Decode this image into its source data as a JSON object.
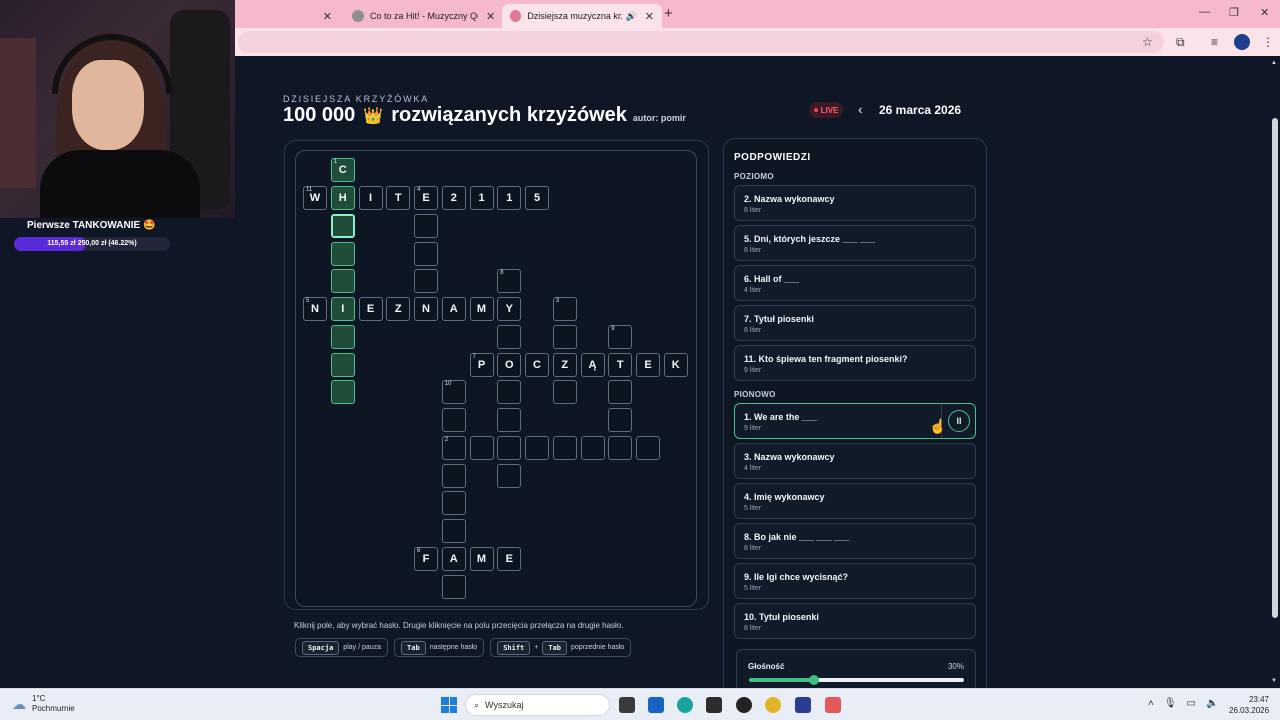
{
  "browser": {
    "tabs": [
      {
        "label": "",
        "x": 0
      },
      {
        "label": "Co to za Hit! - Muzyczny Quiz"
      },
      {
        "label": "Dzisiejsza muzyczna krzyżó"
      }
    ],
    "new_tab": "+",
    "minimize": "—",
    "restore": "❐",
    "close": "✕"
  },
  "stream": {
    "donation_title": "Pierwsze TANKOWANIE 🤩",
    "donation_text": "115,55 zł  250,00 zł (46.22%)",
    "donation_progress": 0.4622
  },
  "header": {
    "subtitle": "DZISIEJSZA KRZYŻÓWKA",
    "count": "100 000",
    "crown": "👑",
    "title": "rozwiązanych krzyżówek",
    "author": "autor: pomir",
    "live": "LIVE",
    "date_prev": "‹",
    "date": "26 marca 2026"
  },
  "board": {
    "hint": "Kliknij pole, aby wybrać hasło. Drugie kliknięcie na polu przecięcia przełącza na drugie hasło.",
    "shortcuts": [
      {
        "keys": [
          "Spacja"
        ],
        "label": "play / pauza"
      },
      {
        "keys": [
          "Tab"
        ],
        "label": "następne hasło"
      },
      {
        "keys": [
          "Shift",
          "Tab"
        ],
        "label": "poprzednie hasło"
      }
    ],
    "plus": "+"
  },
  "clues": {
    "title": "PODPOWIEDZI",
    "across_label": "POZIOMO",
    "down_label": "PIONOWO",
    "across": [
      {
        "text": "2. Nazwa wykonawcy",
        "sub": "8 liter"
      },
      {
        "text": "5. Dni, których jeszcze ___ ___",
        "sub": "8 liter"
      },
      {
        "text": "6. Hall of ___",
        "sub": "4 liter"
      },
      {
        "text": "7. Tytuł piosenki",
        "sub": "8 liter"
      },
      {
        "text": "11. Kto śpiewa ten fragment piosenki?",
        "sub": "9 liter"
      }
    ],
    "down": [
      {
        "text": "1. We are the ___",
        "sub": "9 liter",
        "active": true
      },
      {
        "text": "3. Nazwa wykonawcy",
        "sub": "4 liter"
      },
      {
        "text": "4. Imię wykonawcy",
        "sub": "5 liter"
      },
      {
        "text": "8. Bo jak nie ___ ___ ___",
        "sub": "8 liter"
      },
      {
        "text": "9. Ile Igi chce wycisnąć?",
        "sub": "5 liter"
      },
      {
        "text": "10. Tytuł piosenki",
        "sub": "8 liter"
      }
    ],
    "pause_icon": "II",
    "volume_label": "Głośność",
    "volume_value": "30%",
    "volume_level": 0.3
  },
  "taskbar": {
    "temp": "1°C",
    "weather": "Pochmurnie",
    "search": "Wyszukaj",
    "time": "23:47",
    "date": "26.03.2026"
  },
  "colors": {
    "accent": "#4fbf8a",
    "live": "#ff5a6a",
    "donation": "#5a2bd8",
    "tabbar": "#f6b9cc"
  }
}
